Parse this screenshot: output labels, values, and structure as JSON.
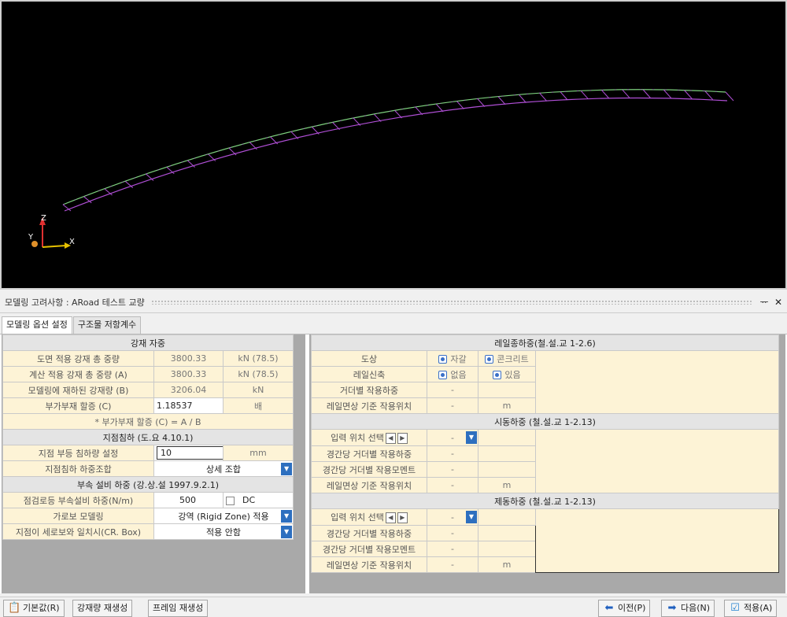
{
  "panel": {
    "title": "모델링 고려사항 : ARoad 테스트 교량",
    "pin": "ᅲ",
    "close": "✕"
  },
  "tabs": [
    {
      "label": "모델링 옵션 설정"
    },
    {
      "label": "구조물 저항계수"
    }
  ],
  "left": {
    "steel": {
      "header": "강재 자중",
      "rows": [
        {
          "label": "도면 적용 강재 총 중량",
          "value": "3800.33",
          "unit": "kN (78.5)"
        },
        {
          "label": "계산 적용 강재 총 중량 (A)",
          "value": "3800.33",
          "unit": "kN (78.5)"
        },
        {
          "label": "모델링에 재하된 강재량 (B)",
          "value": "3206.04",
          "unit": "kN"
        },
        {
          "label": "부가부재 할증 (C)",
          "value": "1.18537",
          "unit": "배"
        }
      ],
      "note": "* 부가부재 할증 (C) = A / B"
    },
    "settle": {
      "header": "지점침하 (도.요 4.10.1)",
      "r1": {
        "label": "지점 부등 침하량 설정",
        "value": "10",
        "unit": "mm"
      },
      "r2": {
        "label": "지점침하 하중조합",
        "value": "상세 조합"
      }
    },
    "attach": {
      "header": "부속 설비 하중 (강.상.설 1997.9.2.1)",
      "r1": {
        "label": "점검로등 부속설비 하중(N/m)",
        "value": "500",
        "dc": "DC"
      },
      "r2": {
        "label": "가로보 모델링",
        "value": "강역 (Rigid Zone) 적용"
      },
      "r3": {
        "label": "지점이 세로보와 일치시(CR. Box)",
        "value": "적용 안함"
      }
    }
  },
  "right": {
    "longi": {
      "header": "레일종하중(철.설.교 1-2.6)",
      "ballast": {
        "label": "도상",
        "opt1": "자갈",
        "opt2": "콘크리트"
      },
      "expan": {
        "label": "레일신축",
        "opt1": "없음",
        "opt2": "있음"
      },
      "load": {
        "label": "거더별 작용하중",
        "value": "-"
      },
      "pos": {
        "label": "레일면상 기준 작용위치",
        "value": "-",
        "unit": "m"
      }
    },
    "start": {
      "header": "시동하중 (철.설.교 1-2.13)",
      "sel": {
        "label": "입력 위치 선택",
        "value": "-"
      },
      "load": {
        "label": "경간당 거더별 작용하중",
        "value": "-"
      },
      "moment": {
        "label": "경간당 거더별 작용모멘트",
        "value": "-"
      },
      "pos": {
        "label": "레일면상 기준 작용위치",
        "value": "-",
        "unit": "m"
      }
    },
    "brake": {
      "header": "제동하중 (철.설.교 1-2.13)",
      "sel": {
        "label": "입력 위치 선택",
        "value": "-"
      },
      "load": {
        "label": "경간당 거더별 작용하중",
        "value": "-"
      },
      "moment": {
        "label": "경간당 거더별 작용모멘트",
        "value": "-"
      },
      "pos": {
        "label": "레일면상 기준 작용위치",
        "value": "-",
        "unit": "m"
      }
    }
  },
  "buttons": {
    "default": "기본값(R)",
    "steel_regen": "강재량 재생성",
    "frame_regen": "프레임 재생성",
    "prev": "이전(P)",
    "next": "다음(N)",
    "apply": "적용(A)"
  },
  "axis": {
    "z": "Z",
    "y": "Y",
    "x": "X"
  }
}
